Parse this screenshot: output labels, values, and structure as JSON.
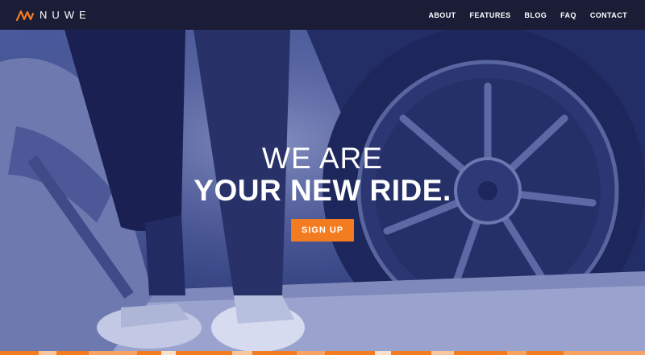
{
  "brand": {
    "name": "NUWE",
    "logo_icon": "nuwe-logo-icon",
    "logo_color": "#f47c20"
  },
  "nav": {
    "links": [
      {
        "label": "ABOUT"
      },
      {
        "label": "FEATURES"
      },
      {
        "label": "BLOG"
      },
      {
        "label": "FAQ"
      },
      {
        "label": "CONTACT"
      }
    ]
  },
  "hero": {
    "line1": "WE ARE",
    "line2": "YOUR NEW RIDE.",
    "cta_label": "SIGN UP"
  },
  "colors": {
    "navbar": "#1b1d36",
    "hero_tint": "#2f3c7a",
    "accent": "#f47c20",
    "text": "#ffffff"
  }
}
